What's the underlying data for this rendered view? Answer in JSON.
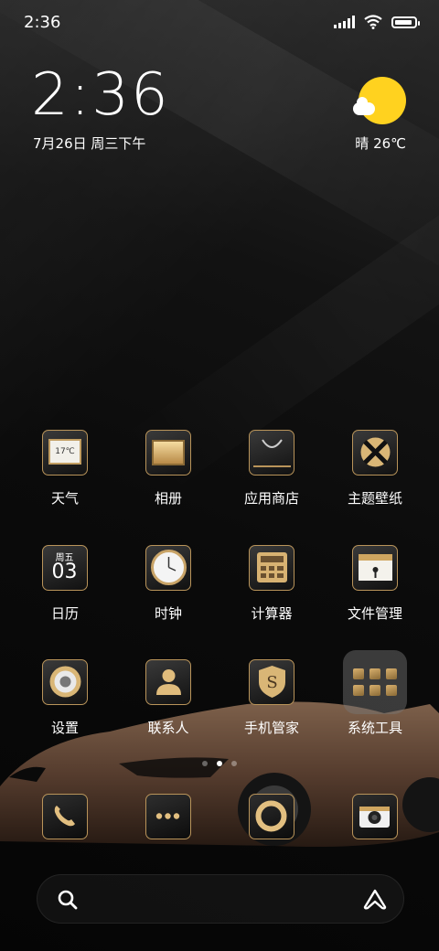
{
  "status_bar": {
    "time": "2:36"
  },
  "clock_widget": {
    "time": "2:36",
    "date": "7月26日 周三下午"
  },
  "weather_widget": {
    "text": "晴 26℃",
    "icon": "sunny-cloud-icon"
  },
  "apps": [
    {
      "label": "天气",
      "icon": "weather-icon",
      "sub": "17℃"
    },
    {
      "label": "相册",
      "icon": "gallery-icon"
    },
    {
      "label": "应用商店",
      "icon": "app-store-icon"
    },
    {
      "label": "主题壁纸",
      "icon": "themes-icon"
    },
    {
      "label": "日历",
      "icon": "calendar-icon",
      "weekday": "周五",
      "day": "03"
    },
    {
      "label": "时钟",
      "icon": "clock-icon"
    },
    {
      "label": "计算器",
      "icon": "calculator-icon"
    },
    {
      "label": "文件管理",
      "icon": "file-manager-icon"
    },
    {
      "label": "设置",
      "icon": "settings-icon"
    },
    {
      "label": "联系人",
      "icon": "contacts-icon"
    },
    {
      "label": "手机管家",
      "icon": "security-icon"
    },
    {
      "label": "系统工具",
      "icon": "folder-icon"
    }
  ],
  "dock": [
    {
      "name": "phone",
      "icon": "phone-icon"
    },
    {
      "name": "messages",
      "icon": "messages-icon"
    },
    {
      "name": "browser",
      "icon": "browser-icon"
    },
    {
      "name": "camera",
      "icon": "camera-icon"
    }
  ],
  "page_indicator": {
    "pages": 3,
    "current": 2
  },
  "search_bar": {
    "icon": "search-icon",
    "assistant_icon": "assistant-icon"
  },
  "colors": {
    "gold": "#b9945a",
    "sun": "#ffd21f"
  }
}
